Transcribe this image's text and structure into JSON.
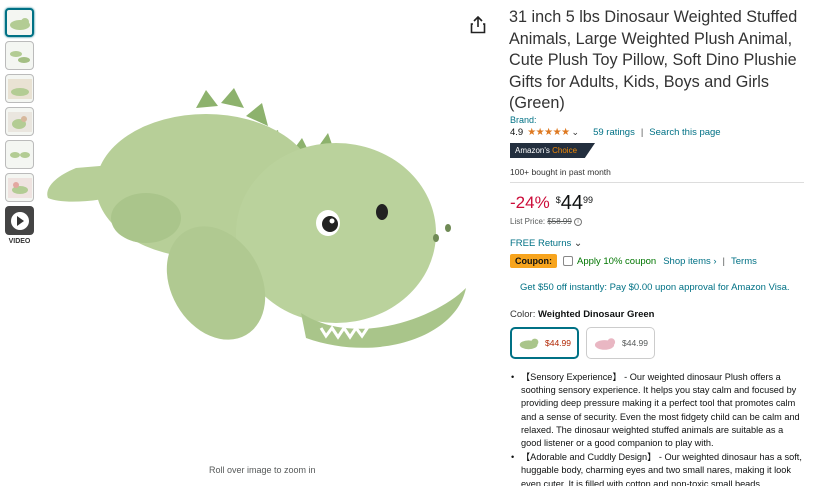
{
  "gallery": {
    "thumbnails": [
      "thumb-1",
      "thumb-2",
      "thumb-3",
      "thumb-4",
      "thumb-5",
      "thumb-6"
    ],
    "video_label": "VIDEO",
    "zoom_hint": "Roll over image to zoom in"
  },
  "product": {
    "title": "31 inch 5 lbs Dinosaur Weighted Stuffed Animals, Large Weighted Plush Animal, Cute Plush Toy Pillow, Soft Dino Plushie Gifts for Adults, Kids, Boys and Girls (Green)",
    "brand_label": "Brand:",
    "rating": "4.9",
    "stars": "★★★★★",
    "ratings_count": "59 ratings",
    "search_page": "Search this page",
    "badge_prefix": "Amazon's",
    "badge_suffix": "Choice",
    "bought": "100+ bought in past month"
  },
  "pricing": {
    "discount": "-24%",
    "currency": "$",
    "whole": "44",
    "fraction": "99",
    "list_label": "List Price:",
    "list_price": "$58.99",
    "free_returns": "FREE Returns",
    "coupon_label": "Coupon:",
    "coupon_text": "Apply 10% coupon",
    "shop_items": "Shop items ›",
    "terms": "Terms",
    "visa_offer": "Get $50 off instantly: Pay $0.00 upon approval for Amazon Visa."
  },
  "variants": {
    "color_label": "Color:",
    "color_value": "Weighted Dinosaur Green",
    "options": [
      {
        "price": "$44.99",
        "color": "#a9c58a"
      },
      {
        "price": "$44.99",
        "color": "#e9b7c3"
      }
    ]
  },
  "bullets": [
    "【Sensory Experience】 - Our weighted dinosaur Plush offers a soothing sensory experience. It helps you stay calm and focused by providing deep pressure making it a perfect tool that promotes calm and a sense of security. Even the most fidgety child can be calm and relaxed. The dinosaur weighted stuffed animals are suitable as a good listener or a good companion to play with.",
    "【Adorable and Cuddly Design】 - Our weighted dinosaur has a soft, huggable body, charming eyes and two small nares, making it look even cuter. It is filled with cotton and non-toxic small beads"
  ],
  "colors": {
    "plush_green": "#b3cc94",
    "link": "#007185",
    "discount_red": "#cc0c39",
    "coupon_orange": "#f7a41d"
  }
}
